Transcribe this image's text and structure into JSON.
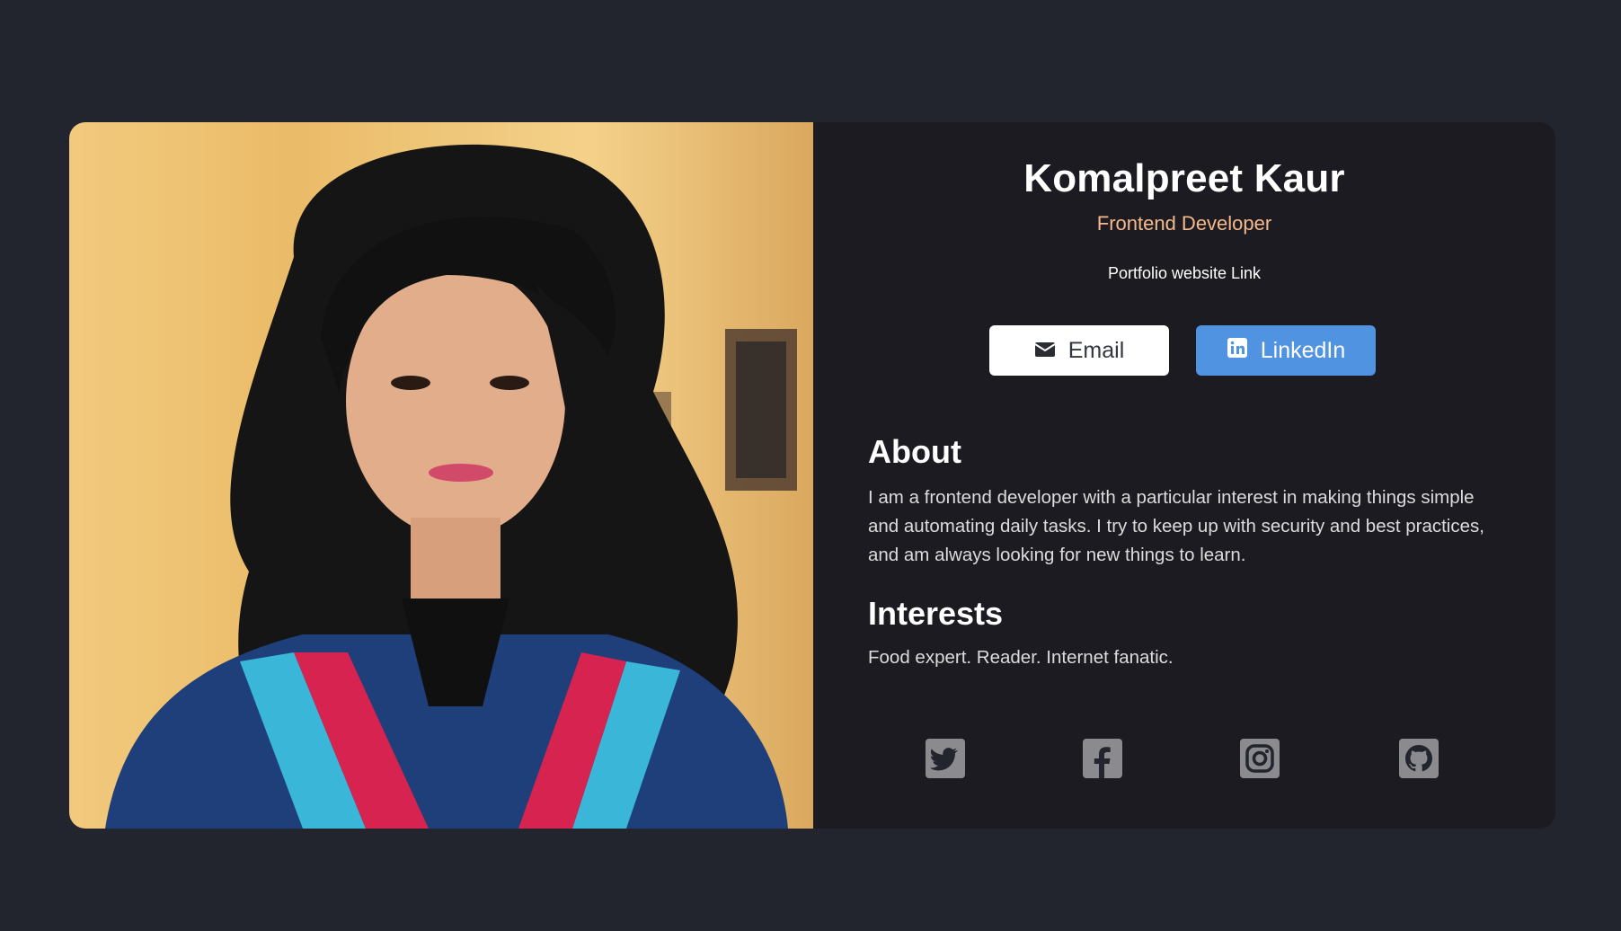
{
  "profile": {
    "name": "Komalpreet Kaur",
    "role": "Frontend Developer",
    "portfolio_link": "Portfolio website Link"
  },
  "buttons": {
    "email": {
      "label": "Email",
      "icon": "envelope-icon"
    },
    "linkedin": {
      "label": "LinkedIn",
      "icon": "linkedin-icon"
    }
  },
  "about": {
    "title": "About",
    "text": "I am a frontend developer with a particular interest in making things simple and automating daily tasks. I try to keep up with security and best practices, and am always looking for new things to learn."
  },
  "interests": {
    "title": "Interests",
    "text": "Food expert. Reader. Internet fanatic."
  },
  "social": [
    "twitter-icon",
    "facebook-icon",
    "instagram-icon",
    "github-icon"
  ],
  "colors": {
    "page_bg": "#23252e",
    "card_bg": "#1b1b21",
    "role_accent": "#f5b98c",
    "linkedin_button": "#5093e1",
    "social_icon": "#8a8a8f"
  }
}
